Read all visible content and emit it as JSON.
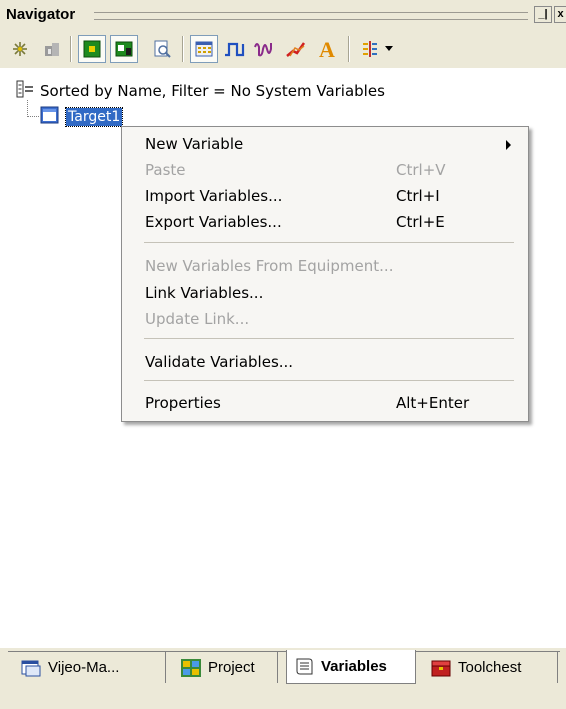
{
  "window": {
    "title": "Navigator",
    "pin_glyph": "_|",
    "close_glyph": "x"
  },
  "toolbar": {
    "icons": [
      "asterisk-icon",
      "columns-icon",
      "green-square-icon",
      "green-window-icon",
      "preview-icon",
      "grid-icon",
      "pulse-icon",
      "waveform-icon",
      "trend-icon",
      "text-a-icon",
      "split-icon",
      "dropdown-arrow-icon"
    ]
  },
  "tree": {
    "header": "Sorted by Name, Filter = No System Variables",
    "node": "Target1"
  },
  "context_menu": {
    "items": [
      {
        "label": "New Variable",
        "shortcut": "",
        "disabled": false,
        "submenu": true
      },
      {
        "label": "Paste",
        "shortcut": "Ctrl+V",
        "disabled": true,
        "submenu": false
      },
      {
        "label": "Import Variables...",
        "shortcut": "Ctrl+I",
        "disabled": false,
        "submenu": false
      },
      {
        "label": "Export Variables...",
        "shortcut": "Ctrl+E",
        "disabled": false,
        "submenu": false
      },
      {
        "label": "New Variables From Equipment...",
        "shortcut": "",
        "disabled": true,
        "submenu": false
      },
      {
        "label": "Link Variables...",
        "shortcut": "",
        "disabled": false,
        "submenu": false
      },
      {
        "label": "Update Link...",
        "shortcut": "",
        "disabled": true,
        "submenu": false
      },
      {
        "label": "Validate Variables...",
        "shortcut": "",
        "disabled": false,
        "submenu": false
      },
      {
        "label": "Properties",
        "shortcut": "Alt+Enter",
        "disabled": false,
        "submenu": false
      }
    ]
  },
  "tabs": [
    {
      "label": "Vijeo-Ma...",
      "icon": "app-window-icon",
      "active": false
    },
    {
      "label": "Project",
      "icon": "project-tree-icon",
      "active": false
    },
    {
      "label": "Variables",
      "icon": "variables-scroll-icon",
      "active": true
    },
    {
      "label": "Toolchest",
      "icon": "toolchest-icon",
      "active": false
    }
  ]
}
